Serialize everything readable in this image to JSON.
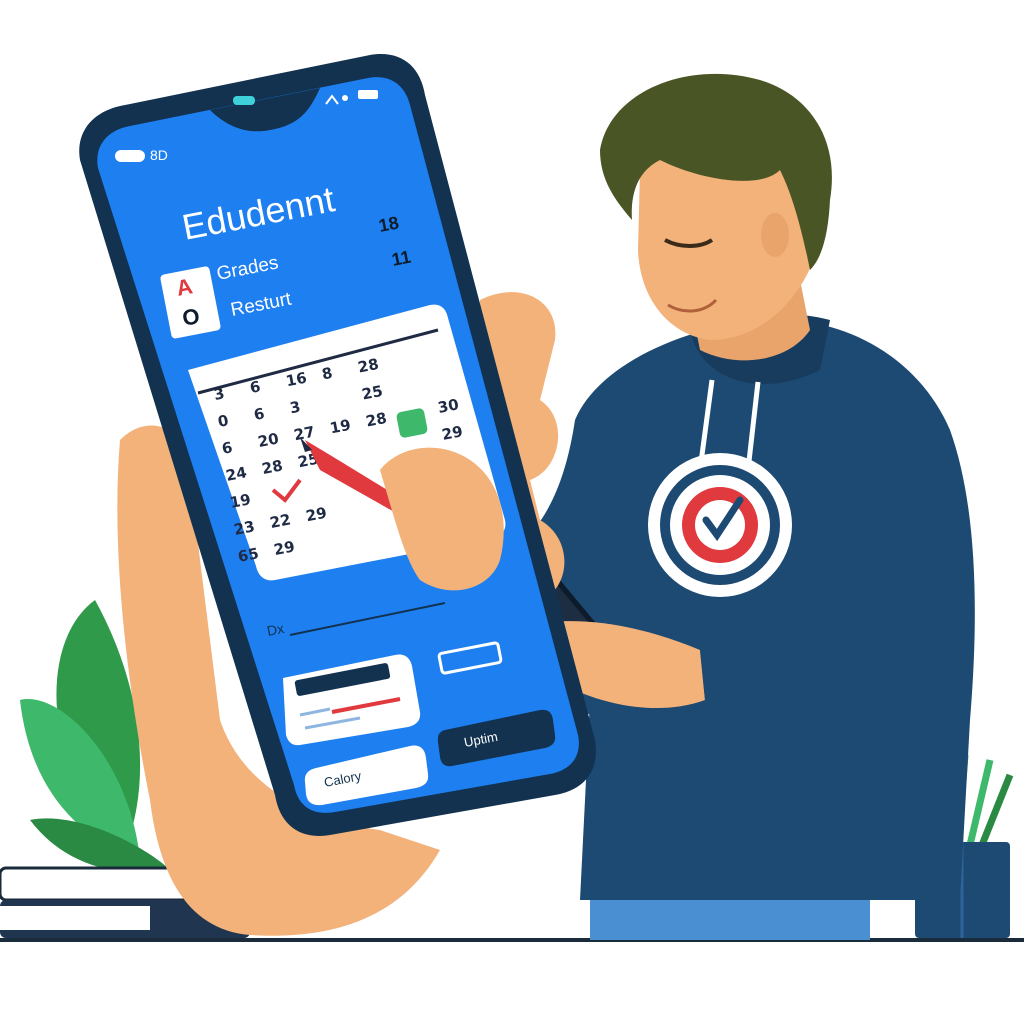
{
  "phone": {
    "status_left": "8D",
    "app_title": "Edudennt",
    "stat_top": "18",
    "stat_bottom": "11",
    "grade_badge_letters": [
      "A",
      "O"
    ],
    "menu_items": [
      {
        "label": "Grades"
      },
      {
        "label": "Resturt"
      }
    ],
    "calendar_rows": [
      [
        "3",
        "6",
        "16",
        "8",
        "28"
      ],
      [
        "0",
        "6",
        "3",
        "",
        "25"
      ],
      [
        "6",
        "20",
        "27",
        "19",
        "28",
        "",
        "30"
      ],
      [
        "24",
        "28",
        "25",
        "",
        "",
        "",
        "29"
      ],
      [
        "19",
        "",
        "",
        "",
        "",
        "",
        ""
      ],
      [
        "23",
        "22",
        "29"
      ],
      [
        "65",
        "29"
      ]
    ],
    "section_label": "Dx",
    "calory_button": "Calory",
    "upload_button": "Uptim"
  },
  "colors": {
    "phone_screen": "#1e7ff0",
    "phone_frame": "#12324f",
    "hoodie": "#1d4a73",
    "skin": "#f2b27a",
    "plant": "#2f9a4a",
    "accent_red": "#e0393e"
  },
  "icons": [
    "check-target-icon",
    "pencil-icon",
    "wifi-icon",
    "battery-icon"
  ]
}
